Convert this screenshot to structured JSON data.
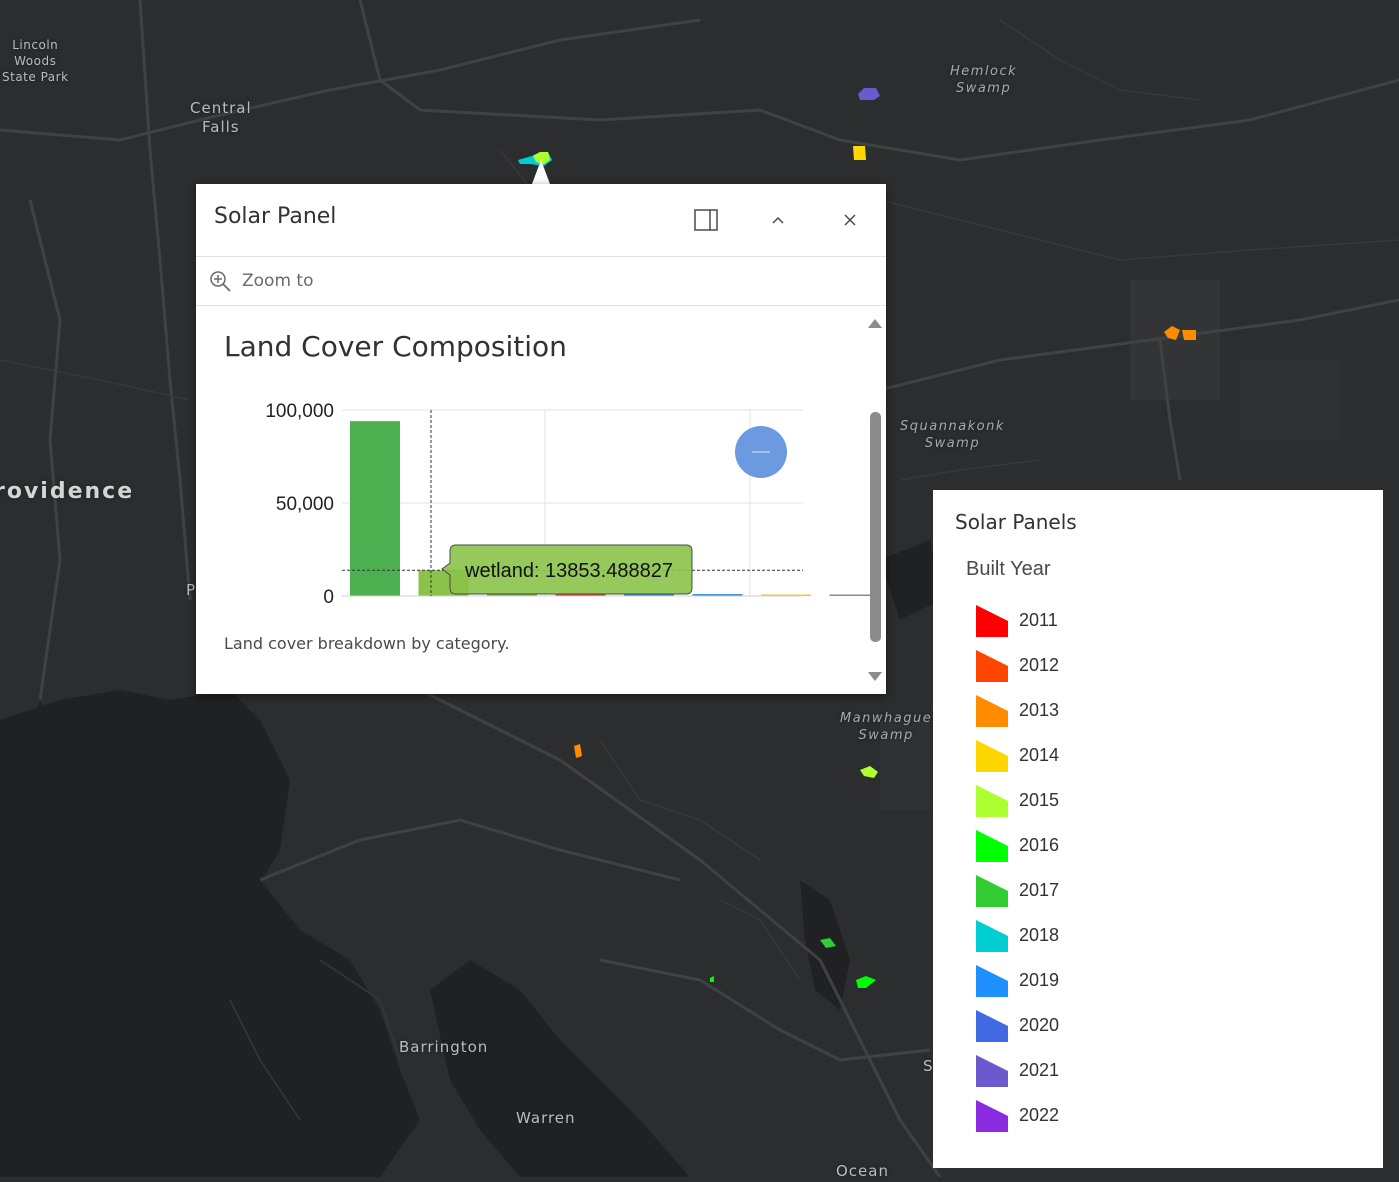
{
  "map": {
    "labels": {
      "lincoln": "Lincoln\nWoods\nState Park",
      "central_falls": "Central\nFalls",
      "hemlock": "Hemlock\nSwamp",
      "squannakonk": "Squannakonk\nSwamp",
      "manwhague": "Manwhague\nSwamp",
      "providence": "rovidence",
      "barrington": "Barrington",
      "warren": "Warren",
      "ocean": "Ocean",
      "p_fragment": "P",
      "s_fragment": "S"
    },
    "colors": {
      "background": "#2b2d2e",
      "water": "#1f2122",
      "road": "#3f4243"
    }
  },
  "popup": {
    "title": "Solar Panel",
    "dock_icon": "dock-icon",
    "collapse_icon": "chevron-up-icon",
    "close_icon": "close-icon",
    "zoom_icon": "zoom-in-icon",
    "zoom_label": "Zoom to",
    "content_title": "Land Cover Composition",
    "description": "Land cover breakdown by category.",
    "tooltip": "wetland: 13853.488827",
    "scroll_up_icon": "triangle-up-icon",
    "scroll_down_icon": "triangle-down-icon",
    "cursor_icon": "cursor-circle-icon"
  },
  "chart_data": {
    "type": "bar",
    "categories": [
      "",
      "wetland",
      "",
      "",
      "",
      "",
      "",
      ""
    ],
    "values": [
      94000,
      13853.488827,
      300,
      200,
      1200,
      1000,
      600,
      500
    ],
    "colors": [
      "#4caf50",
      "#8bc34a",
      "#7cb342",
      "#e53935",
      "#1e88e5",
      "#1e88e5",
      "#fbc02d",
      "#78909c"
    ],
    "ylim": [
      0,
      100000
    ],
    "yticks": [
      "100,000",
      "50,000",
      "0"
    ],
    "ytick_values": [
      100000,
      50000,
      0
    ],
    "highlight_index": 1,
    "grid": true,
    "title": "Land Cover Composition"
  },
  "legend": {
    "title": "Solar Panels",
    "subtitle": "Built Year",
    "items": [
      {
        "label": "2011",
        "color": "#ff0000"
      },
      {
        "label": "2012",
        "color": "#ff4500"
      },
      {
        "label": "2013",
        "color": "#ff8c00"
      },
      {
        "label": "2014",
        "color": "#ffd700"
      },
      {
        "label": "2015",
        "color": "#adff2f"
      },
      {
        "label": "2016",
        "color": "#00ff00"
      },
      {
        "label": "2017",
        "color": "#32cd32"
      },
      {
        "label": "2018",
        "color": "#00ced1"
      },
      {
        "label": "2019",
        "color": "#1e90ff"
      },
      {
        "label": "2020",
        "color": "#4169e1"
      },
      {
        "label": "2021",
        "color": "#6a5acd"
      },
      {
        "label": "2022",
        "color": "#8a2be2"
      }
    ]
  }
}
